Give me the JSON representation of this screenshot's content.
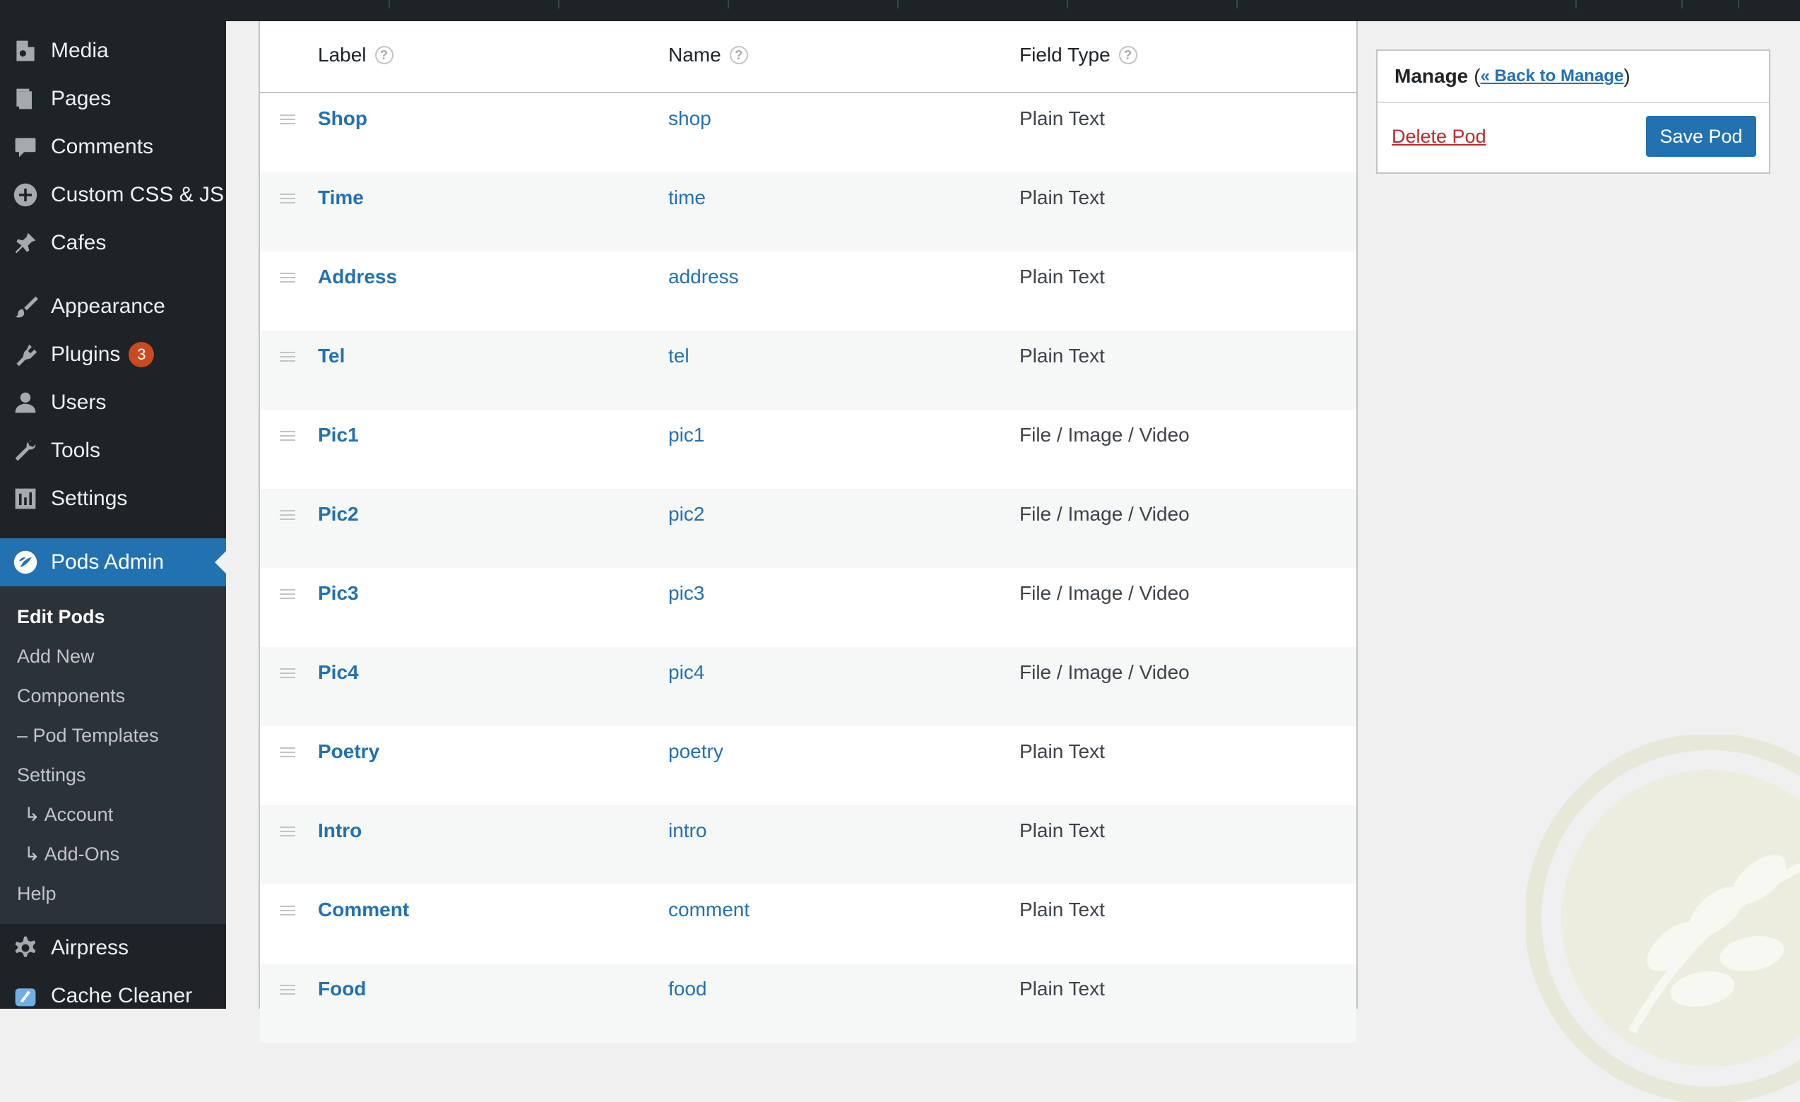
{
  "sidebar": {
    "items": [
      {
        "label": "Media",
        "icon": "media-icon"
      },
      {
        "label": "Pages",
        "icon": "pages-icon"
      },
      {
        "label": "Comments",
        "icon": "comments-icon"
      },
      {
        "label": "Custom CSS & JS",
        "icon": "plus-circle-icon"
      },
      {
        "label": "Cafes",
        "icon": "pin-icon"
      },
      {
        "label": "Appearance",
        "icon": "paintbrush-icon"
      },
      {
        "label": "Plugins",
        "icon": "plugin-icon",
        "badge": "3"
      },
      {
        "label": "Users",
        "icon": "users-icon"
      },
      {
        "label": "Tools",
        "icon": "wrench-icon"
      },
      {
        "label": "Settings",
        "icon": "settings-icon"
      },
      {
        "label": "Pods Admin",
        "icon": "pods-icon"
      },
      {
        "label": "Airpress",
        "icon": "gear-icon"
      },
      {
        "label": "Cache Cleaner",
        "icon": "cache-cleaner-icon"
      }
    ],
    "submenu": [
      {
        "label": "Edit Pods"
      },
      {
        "label": "Add New"
      },
      {
        "label": "Components"
      },
      {
        "label": "– Pod Templates"
      },
      {
        "label": "Settings"
      },
      {
        "label": "↳ Account"
      },
      {
        "label": "↳ Add-Ons"
      },
      {
        "label": "Help"
      }
    ]
  },
  "table": {
    "headers": {
      "label": "Label",
      "name": "Name",
      "type": "Field Type"
    },
    "rows": [
      {
        "label": "Shop",
        "name": "shop",
        "type": "Plain Text"
      },
      {
        "label": "Time",
        "name": "time",
        "type": "Plain Text"
      },
      {
        "label": "Address",
        "name": "address",
        "type": "Plain Text"
      },
      {
        "label": "Tel",
        "name": "tel",
        "type": "Plain Text"
      },
      {
        "label": "Pic1",
        "name": "pic1",
        "type": "File / Image / Video"
      },
      {
        "label": "Pic2",
        "name": "pic2",
        "type": "File / Image / Video"
      },
      {
        "label": "Pic3",
        "name": "pic3",
        "type": "File / Image / Video"
      },
      {
        "label": "Pic4",
        "name": "pic4",
        "type": "File / Image / Video"
      },
      {
        "label": "Poetry",
        "name": "poetry",
        "type": "Plain Text"
      },
      {
        "label": "Intro",
        "name": "intro",
        "type": "Plain Text"
      },
      {
        "label": "Comment",
        "name": "comment",
        "type": "Plain Text"
      },
      {
        "label": "Food",
        "name": "food",
        "type": "Plain Text"
      }
    ]
  },
  "manage": {
    "title": "Manage",
    "paren_open": "(",
    "back_link": "« Back to Manage",
    "paren_close": ")",
    "delete_label": "Delete Pod",
    "save_label": "Save Pod"
  },
  "colors": {
    "sidebar_bg": "#1d2327",
    "accent": "#2271b1",
    "badge": "#ca4a1f",
    "delete": "#b32d2e"
  }
}
